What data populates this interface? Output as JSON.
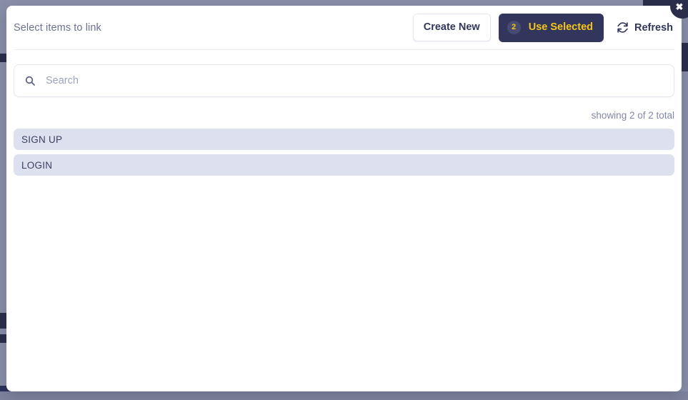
{
  "modal": {
    "title": "Select items to link",
    "close_icon": "close-icon",
    "actions": {
      "create_new_label": "Create New",
      "use_selected_label": "Use Selected",
      "selected_count": "2",
      "refresh_label": "Refresh",
      "refresh_icon": "refresh-icon"
    },
    "search": {
      "value": "",
      "placeholder": "Search",
      "icon": "search-icon"
    },
    "result_count_text": "showing 2 of 2 total",
    "items": [
      {
        "label": "SIGN UP"
      },
      {
        "label": "LOGIN"
      }
    ]
  },
  "colors": {
    "accent_yellow": "#f5c518",
    "primary_navy": "#33365c",
    "backdrop": "#8a8fa8",
    "item_bg": "#dde0ee",
    "muted_text": "#6c7193"
  }
}
